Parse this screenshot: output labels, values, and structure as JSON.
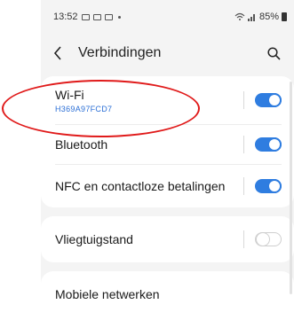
{
  "status_bar": {
    "time": "13:52",
    "battery": "85%"
  },
  "app_bar": {
    "title": "Verbindingen",
    "back_icon": "chevron-left-icon",
    "search_icon": "search-icon"
  },
  "settings": [
    {
      "label": "Wi-Fi",
      "sublabel": "H369A97FCD7",
      "enabled": true
    },
    {
      "label": "Bluetooth",
      "enabled": true
    },
    {
      "label": "NFC en contactloze betalingen",
      "enabled": true
    },
    {
      "label": "Vliegtuigstand",
      "enabled": false
    },
    {
      "label": "Mobiele netwerken"
    }
  ],
  "colors": {
    "accent": "#2f7de0",
    "annotation": "#e01a1a",
    "background": "#f4f4f4"
  }
}
